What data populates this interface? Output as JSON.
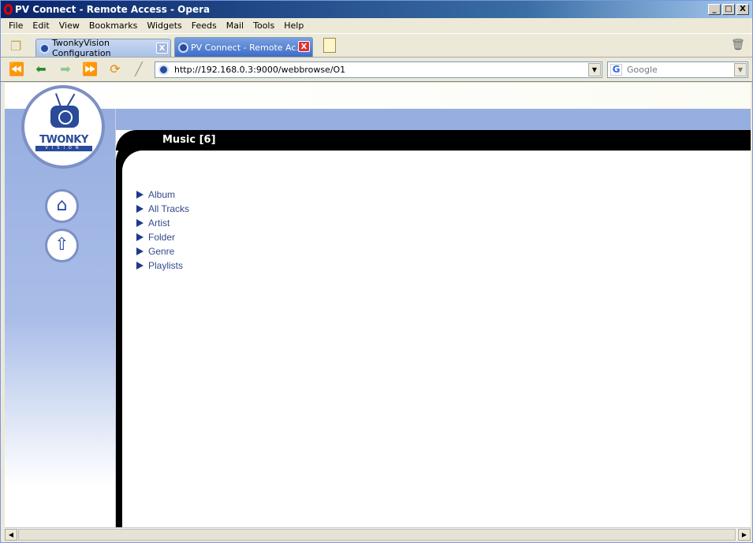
{
  "window": {
    "title": "PV Connect - Remote Access - Opera",
    "min": "_",
    "max": "□",
    "close": "X"
  },
  "menu": [
    "File",
    "Edit",
    "View",
    "Bookmarks",
    "Widgets",
    "Feeds",
    "Mail",
    "Tools",
    "Help"
  ],
  "tabs": [
    {
      "label": "TwonkyVision Configuration",
      "active": false
    },
    {
      "label": "PV Connect - Remote Ac...",
      "active": true
    }
  ],
  "address": {
    "url": "http://192.168.0.3:9000/webbrowse/O1"
  },
  "search": {
    "placeholder": "Google"
  },
  "logo": {
    "line1": "TWONKY",
    "line2": "VISION"
  },
  "page": {
    "header": "Music [6]",
    "items": [
      "Album",
      "All Tracks",
      "Artist",
      "Folder",
      "Genre",
      "Playlists"
    ]
  },
  "colors": {
    "accent": "#2a4a9a",
    "band": "#97aee0",
    "link": "#334c8c"
  }
}
